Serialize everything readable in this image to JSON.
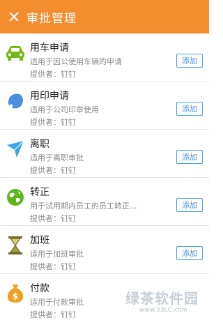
{
  "header": {
    "title": "审批管理",
    "background": "#f38d2e"
  },
  "add_label": "添加",
  "items": [
    {
      "title": "用车申请",
      "desc": "适用于因公使用车辆的申请",
      "provider": "提供者：钉钉",
      "icon": "car-icon",
      "icon_color": "#74b816"
    },
    {
      "title": "用印申请",
      "desc": "适用于公司印章使用",
      "provider": "提供者：钉钉",
      "icon": "seal-icon",
      "icon_color": "#4a8fdf"
    },
    {
      "title": "离职",
      "desc": "适用于离职审批",
      "provider": "提供者：钉钉",
      "icon": "paper-plane-icon",
      "icon_color": "#3ba6e8"
    },
    {
      "title": "转正",
      "desc": "用于试用期内员工的员工转正...",
      "provider": "提供者：钉钉",
      "icon": "globe-icon",
      "icon_color": "#5cb61c"
    },
    {
      "title": "加班",
      "desc": "适用于加班审批",
      "provider": "提供者：钉钉",
      "icon": "hourglass-icon",
      "icon_color": "#8d8a3c"
    },
    {
      "title": "付款",
      "desc": "适用于付款审批",
      "provider": "提供者：钉钉",
      "icon": "money-bag-icon",
      "icon_color": "#f0a020"
    }
  ],
  "watermark": {
    "text": "绿茶软件园",
    "url": "www.33LC.com"
  }
}
